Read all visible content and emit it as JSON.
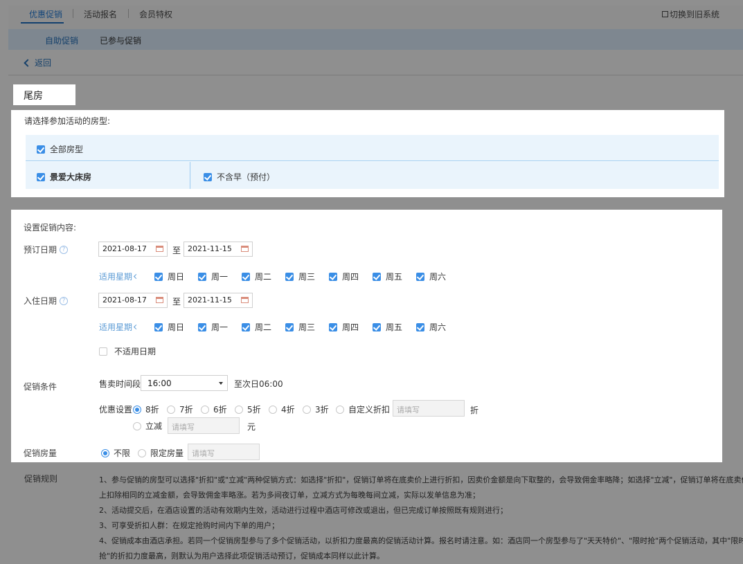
{
  "top_tabs": [
    "优惠促销",
    "活动报名",
    "会员特权"
  ],
  "switch_label": "切换到旧系统",
  "sub_tabs": [
    "自助促销",
    "已参与促销"
  ],
  "back_label": "返回",
  "section_title": "尾房",
  "room_select": {
    "label": "请选择参加活动的房型:",
    "all_rooms": "全部房型",
    "room_name": "景爱大床房",
    "rate_plan": "不含早（预付）"
  },
  "promo": {
    "heading": "设置促销内容:",
    "booking_date_label": "预订日期",
    "checkin_date_label": "入住日期",
    "booking_start": "2021-08-17",
    "booking_end": "2021-11-15",
    "checkin_start": "2021-08-17",
    "checkin_end": "2021-11-15",
    "to": "至",
    "weekday_label": "适用星期",
    "weekdays": [
      "周日",
      "周一",
      "周二",
      "周三",
      "周四",
      "周五",
      "周六"
    ],
    "exclude_dates": "不适用日期",
    "condition_label": "促销条件",
    "sale_period_label": "售卖时间段",
    "sale_period_value": "16:00",
    "sale_until": "至次日06:00",
    "discount_label": "优惠设置",
    "discounts": [
      "8折",
      "7折",
      "6折",
      "5折",
      "4折",
      "3折",
      "自定义折扣"
    ],
    "discount_placeholder": "请填写",
    "discount_unit": "折",
    "reduce_label": "立减",
    "reduce_placeholder": "请填写",
    "reduce_unit": "元",
    "quantity_label": "促销房量",
    "quantity_unlimited": "不限",
    "quantity_limited": "限定房量",
    "quantity_placeholder": "请填写"
  },
  "rules": {
    "label": "促销规则",
    "lines": [
      "1、参与促销的房型可以选择\"折扣\"或\"立减\"两种促销方式：如选择\"折扣\"，促销订单将在底卖价上进行折扣，因卖价金额是向下取整的，会导致佣金率略降；如选择\"立减\"，促销订单将在底卖价",
      "上扣除相同的立减金额，会导致佣金率略涨。若为多间夜订单，立减方式为每晚每间立减，实际以发单信息为准；",
      "2、活动提交后，在酒店设置的活动有效期内生效，活动进行过程中酒店可修改或退出，但已完成订单按照既有规则进行；",
      "3、可享受折扣人群：在规定抢购时间内下单的用户；",
      "4、促销成本由酒店承担。若同一个促销房型参与了多个促销活动，以折扣力度最高的促销活动计算。报名时请注意。如：酒店同一个房型参与了\"天天特价\"、\"限时抢\"两个促销活动，其中\"限时",
      "抢\"的折扣力度最高，则默认为用户选择此项促销活动预订，促销成本同样以此计算。"
    ]
  }
}
